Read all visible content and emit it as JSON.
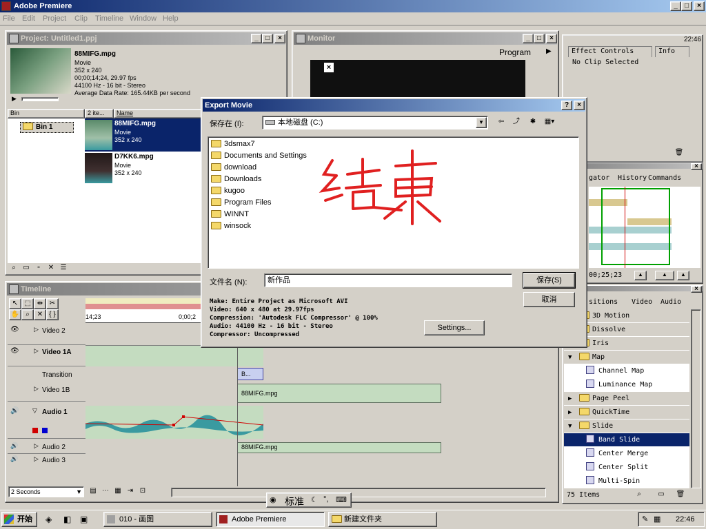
{
  "app": {
    "title": "Adobe Premiere",
    "menu": [
      "File",
      "Edit",
      "Project",
      "Clip",
      "Timeline",
      "Window",
      "Help"
    ]
  },
  "project": {
    "title": "Project: Untitled1.ppj",
    "clip_name": "88MIFG.mpg",
    "clip_type": "Movie",
    "clip_size": "352 x 240",
    "clip_time": "00;00;14;24, 29.97 fps",
    "clip_audio": "44100 Hz - 16 bit - Stereo",
    "clip_rate": "Average Data Rate: 165.44KB per second",
    "bin_header": "Bin",
    "count_header": "2 ite...",
    "name_header": "Name",
    "bin_item": "Bin 1",
    "items": [
      {
        "name": "88MIFG.mpg",
        "type": "Movie",
        "size": "352 x 240"
      },
      {
        "name": "D7KK6.mpg",
        "type": "Movie",
        "size": "352 x 240"
      }
    ]
  },
  "monitor": {
    "title": "Monitor",
    "label": "Program"
  },
  "effects": {
    "tabs": [
      "Effect Controls",
      "Info"
    ],
    "status": "No Clip Selected"
  },
  "navigator": {
    "tabs": [
      "gator",
      "History",
      "Commands"
    ],
    "timecode": "00;25;23"
  },
  "transitions": {
    "tabs": [
      "sitions",
      "Video",
      "Audio"
    ],
    "items": [
      {
        "label": "3D Motion",
        "kind": "folder",
        "expand": "",
        "indent": 0
      },
      {
        "label": "Dissolve",
        "kind": "folder",
        "expand": "",
        "indent": 0
      },
      {
        "label": "Iris",
        "kind": "folder",
        "expand": "",
        "indent": 0
      },
      {
        "label": "Map",
        "kind": "folder",
        "expand": "▼",
        "indent": 0
      },
      {
        "label": "Channel Map",
        "kind": "effect",
        "expand": "",
        "indent": 1
      },
      {
        "label": "Luminance Map",
        "kind": "effect",
        "expand": "",
        "indent": 1
      },
      {
        "label": "Page Peel",
        "kind": "folder",
        "expand": "▶",
        "indent": 0
      },
      {
        "label": "QuickTime",
        "kind": "folder",
        "expand": "▶",
        "indent": 0
      },
      {
        "label": "Slide",
        "kind": "folder",
        "expand": "▼",
        "indent": 0
      },
      {
        "label": "Band Slide",
        "kind": "effect",
        "expand": "",
        "indent": 1,
        "selected": true
      },
      {
        "label": "Center Merge",
        "kind": "effect",
        "expand": "",
        "indent": 1
      },
      {
        "label": "Center Split",
        "kind": "effect",
        "expand": "",
        "indent": 1
      },
      {
        "label": "Multi-Spin",
        "kind": "effect",
        "expand": "",
        "indent": 1
      }
    ],
    "count": "75 Items"
  },
  "timeline": {
    "title": "Timeline",
    "ruler_start": "14;23",
    "ruler_mid": "0;00;2",
    "tracks": {
      "video2": "Video 2",
      "video1a": "Video 1A",
      "transition": "Transition",
      "video1b": "Video 1B",
      "audio1": "Audio 1",
      "audio2": "Audio 2",
      "audio3": "Audio 3"
    },
    "transition_clip": "B...",
    "video_clip": "88MIFG.mpg",
    "audio_clip": "88MIFG.mpg",
    "zoom": "2 Seconds"
  },
  "dialog": {
    "title": "Export Movie",
    "save_in_label": "保存在 (I):",
    "save_in_value": "本地磁盘 (C:)",
    "folders": [
      "3dsmax7",
      "Documents and Settings",
      "download",
      "Downloads",
      "kugoo",
      "Program Files",
      "WINNT",
      "winsock"
    ],
    "filename_label": "文件名 (N):",
    "filename_value": "新作品",
    "save_button": "保存(S)",
    "cancel_button": "取消",
    "summary": [
      "Make: Entire Project as Microsoft AVI",
      "Video: 640 x 480 at 29.97fps",
      "Compression: 'Autodesk FLC Compressor' @ 100%",
      "Audio: 44100 Hz - 16 bit - Stereo",
      "Compressor: Uncompressed"
    ],
    "settings_button": "Settings...",
    "handwriting": "结束"
  },
  "ime": {
    "label": "标准"
  },
  "taskbar": {
    "start": "开始",
    "tasks": [
      "010 - 画图",
      "Adobe Premiere",
      "新建文件夹"
    ],
    "clock": "22:46"
  },
  "clock_small": "22:46",
  "colors": {
    "titlebar": "#0a246a",
    "face": "#d4d0c8",
    "selected": "#0a246a",
    "clip": "#c4dcc0",
    "audio_wave": "#3a9aa0",
    "ink": "#e02020"
  }
}
